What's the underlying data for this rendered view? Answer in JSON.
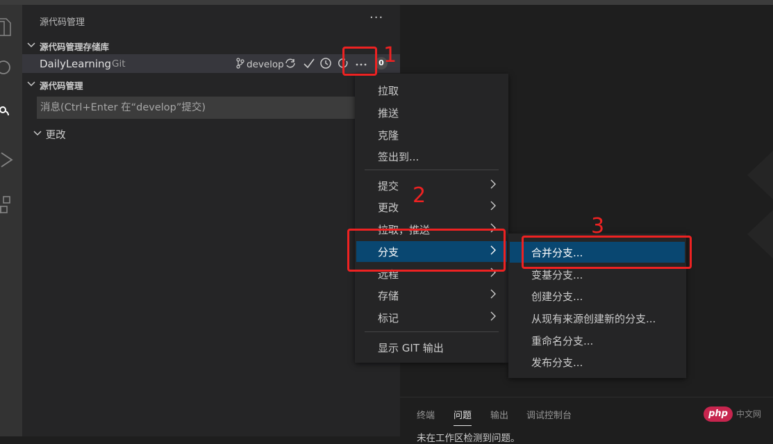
{
  "sidebar": {
    "title": "源代码管理",
    "more_glyph": "···",
    "section_repos": "源代码管理存储库",
    "section_scm": "源代码管理",
    "repo": {
      "name": "DailyLearning",
      "type": "Git",
      "branch": "develop",
      "badge": "0"
    },
    "message_placeholder": "消息(Ctrl+Enter 在“develop”提交)",
    "changes_label": "更改"
  },
  "menu": {
    "items_top": [
      "拉取",
      "推送",
      "克隆",
      "签出到..."
    ],
    "items_sub": [
      "提交",
      "更改",
      "拉取，推送",
      "分支",
      "远程",
      "存储",
      "标记"
    ],
    "selected": "分支",
    "item_bottom": "显示 GIT 输出"
  },
  "submenu": {
    "items": [
      "合并分支...",
      "变基分支...",
      "创建分支...",
      "从现有来源创建新的分支...",
      "重命名分支...",
      "发布分支..."
    ],
    "selected": "合并分支..."
  },
  "annotations": {
    "n1": "1",
    "n2": "2",
    "n3": "3",
    "color": "#ee2222"
  },
  "panel": {
    "tabs": [
      "终端",
      "问题",
      "输出",
      "调试控制台"
    ],
    "active_tab": "问题",
    "status": "未在工作区检测到问题。"
  },
  "watermark": {
    "logo": "php",
    "site": "中文网"
  },
  "colors": {
    "accent_selected": "#094771",
    "sidebar_bg": "#252526",
    "editor_bg": "#1e1e1e"
  },
  "icons": [
    "explorer-icon",
    "search-icon",
    "source-control-icon",
    "run-debug-icon",
    "extensions-icon",
    "branch-icon",
    "sync-icon",
    "check-icon",
    "history-icon",
    "refresh-icon",
    "more-icon",
    "chevron-right-icon",
    "chevron-down-icon"
  ]
}
